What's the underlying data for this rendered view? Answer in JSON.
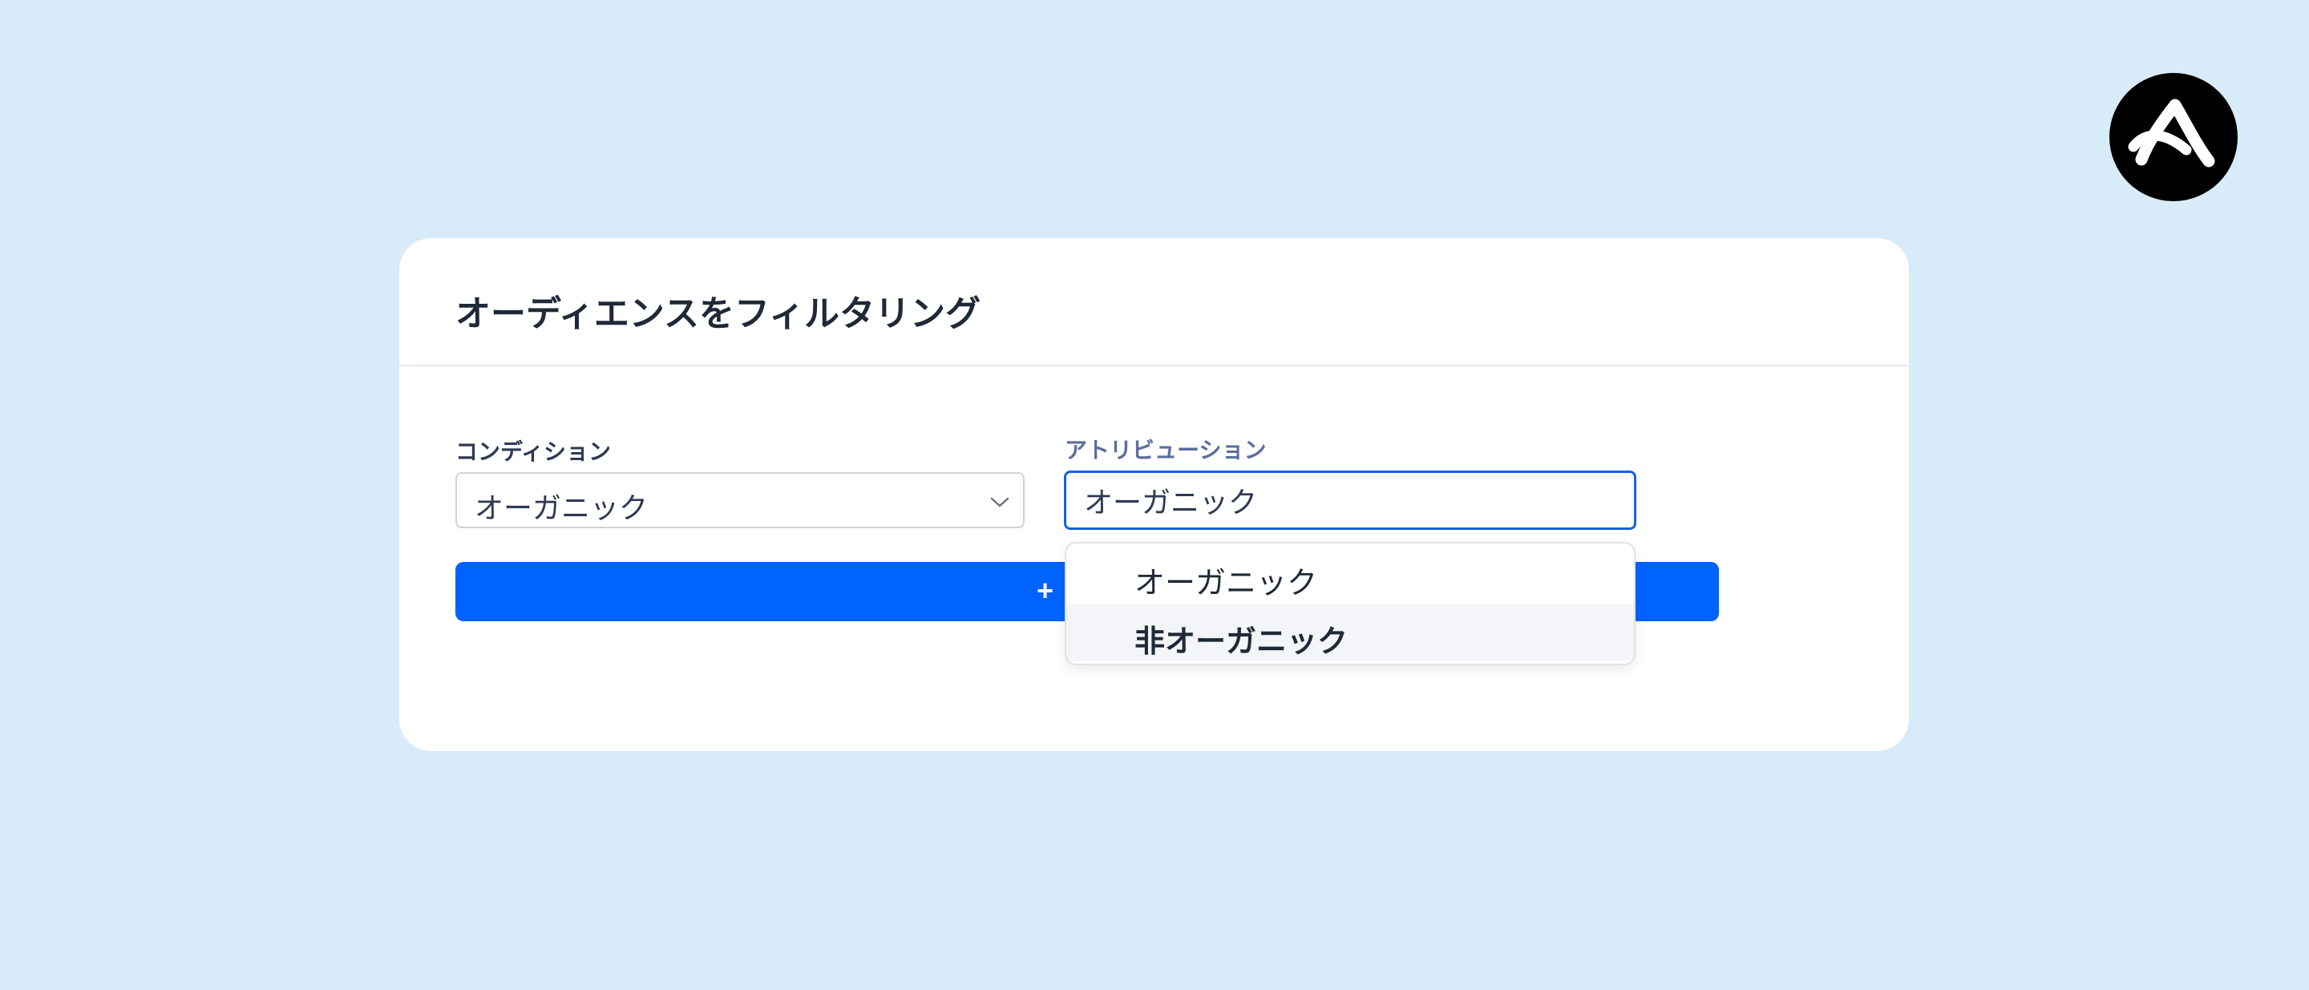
{
  "card": {
    "title": "オーディエンスをフィルタリング"
  },
  "condition": {
    "label": "コンディション",
    "value": "オーガニック"
  },
  "attribution": {
    "label": "アトリビューション",
    "value": "オーガニック"
  },
  "add_button": {
    "icon": "+"
  },
  "dropdown": {
    "options": [
      "オーガニック",
      "非オーガニック"
    ],
    "highlighted": "非オーガニック"
  },
  "colors": {
    "background": "#d8ebf8",
    "card": "#ffffff",
    "accent": "#0062ff",
    "input_focus": "#1263e0",
    "text": "#1f2937"
  },
  "icons": {
    "brand_logo": "brand-logo-icon",
    "chevron": "chevron-down-icon",
    "plus": "plus-icon"
  }
}
